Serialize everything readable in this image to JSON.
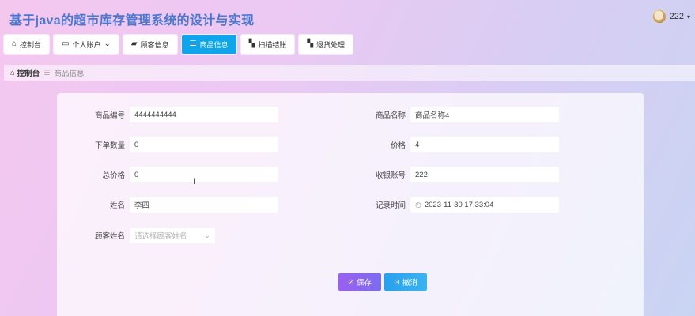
{
  "header": {
    "title": "基于java的超市库存管理系统的设计与实现",
    "username": "222",
    "caret": "▾"
  },
  "nav": [
    {
      "label": "控制台",
      "icon": "home-icon",
      "glyph": "⌂",
      "active": false
    },
    {
      "label": "个人账户",
      "icon": "card-icon",
      "glyph": "▭",
      "active": false,
      "caret": "⌄"
    },
    {
      "label": "顾客信息",
      "icon": "folder-icon",
      "glyph": "▰",
      "active": false
    },
    {
      "label": "商品信息",
      "icon": "sliders-icon",
      "glyph": "☰",
      "active": true
    },
    {
      "label": "扫描结账",
      "icon": "grid-icon",
      "glyph": "▚",
      "active": false
    },
    {
      "label": "退货处理",
      "icon": "grid-icon",
      "glyph": "▚",
      "active": false
    }
  ],
  "breadcrumb": {
    "home": "控制台",
    "separator": "☰",
    "current": "商品信息"
  },
  "form": {
    "product_no_label": "商品编号",
    "product_no_value": "4444444444",
    "product_name_label": "商品名称",
    "product_name_value": "商品名称4",
    "order_qty_label": "下单数量",
    "order_qty_value": "0",
    "price_label": "价格",
    "price_value": "4",
    "total_label": "总价格",
    "total_value": "0",
    "cashier_label": "收银账号",
    "cashier_value": "222",
    "name_label": "姓名",
    "name_value": "李四",
    "record_time_label": "记录时间",
    "record_time_value": "2023-11-30 17:33:04",
    "customer_label": "顾客姓名",
    "customer_placeholder": "请选择顾客姓名"
  },
  "actions": {
    "save_label": "保存",
    "cancel_label": "撤消"
  },
  "colors": {
    "accent": "#0ea5ea",
    "save": "#8e63f0",
    "cancel": "#2aa6ee",
    "title": "#4a78d0"
  }
}
